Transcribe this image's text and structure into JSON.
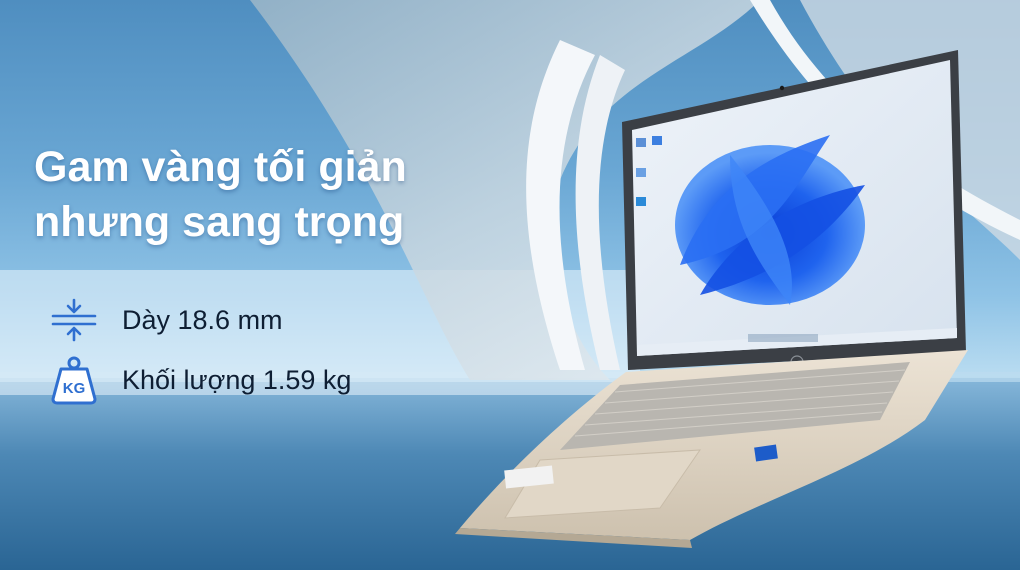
{
  "headline": {
    "line1": "Gam vàng tối giản",
    "line2": "nhưng sang trọng"
  },
  "specs": [
    {
      "icon": "thickness-compress-icon",
      "label": "Dày 18.6 mm"
    },
    {
      "icon": "weight-kg-icon",
      "label": "Khối lượng 1.59 kg"
    }
  ],
  "colors": {
    "headline_text": "#ffffff",
    "spec_text": "#0e1e33",
    "icon_blue": "#2f6fd0",
    "sky": "#6aa7d4",
    "sea": "#2e6a98"
  }
}
